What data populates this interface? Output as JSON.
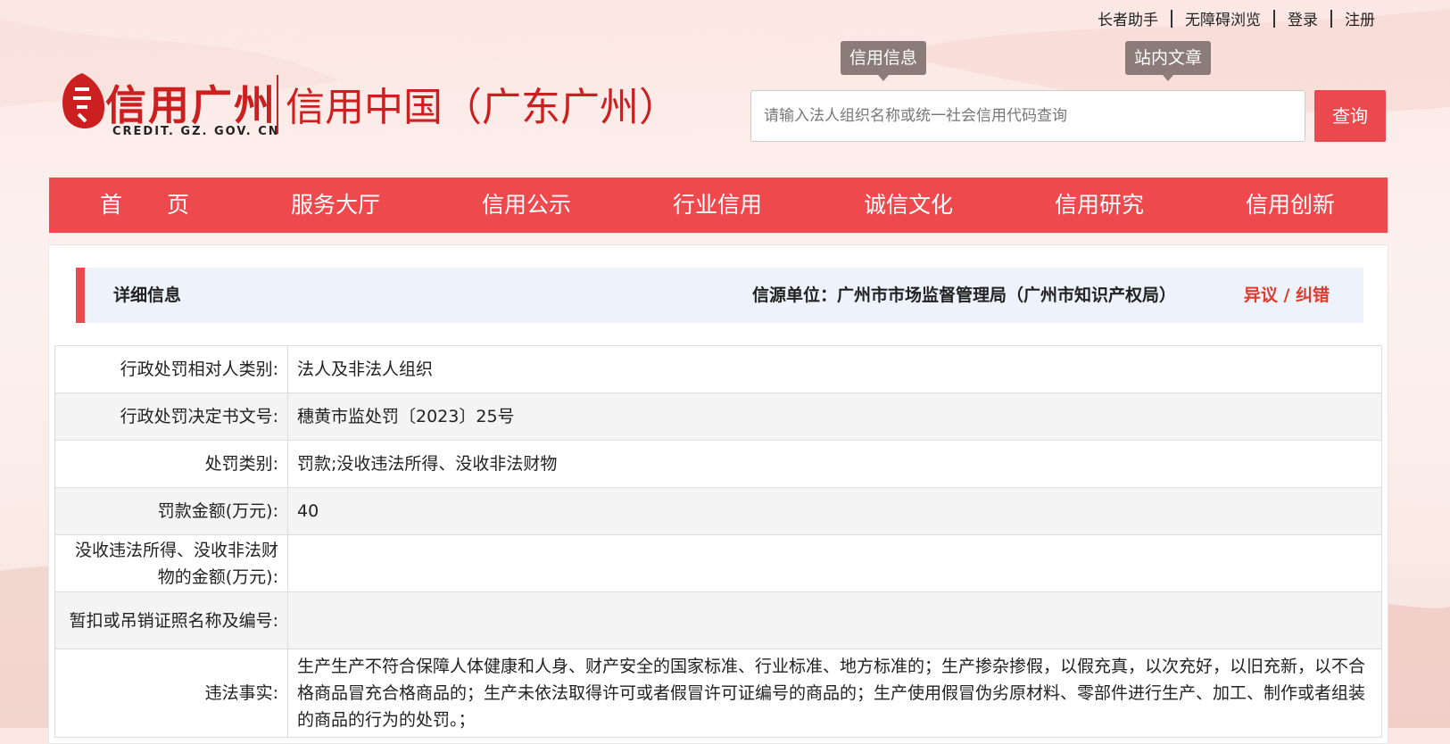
{
  "toplinks": [
    "长者助手",
    "无障碍浏览",
    "登录",
    "注册"
  ],
  "logo": {
    "title_cn": "信用广州",
    "title_en": "CREDIT. GZ. GOV. CN",
    "subtitle": "信用中国（广东广州）"
  },
  "search": {
    "tabs": [
      "信用信息",
      "站内文章"
    ],
    "placeholder": "请输入法人组织名称或统一社会信用代码查询",
    "button": "查询"
  },
  "nav": [
    "首　　页",
    "服务大厅",
    "信用公示",
    "行业信用",
    "诚信文化",
    "信用研究",
    "信用创新"
  ],
  "detail": {
    "title": "详细信息",
    "source": "信源单位：广州市市场监督管理局（广州市知识产权局）",
    "objection": "异议 / 纠错",
    "rows": [
      {
        "label": "行政处罚相对人类别:",
        "value": "法人及非法人组织"
      },
      {
        "label": "行政处罚决定书文号:",
        "value": "穗黄市监处罚〔2023〕25号"
      },
      {
        "label": "处罚类别:",
        "value": "罚款;没收违法所得、没收非法财物"
      },
      {
        "label": "罚款金额(万元):",
        "value": "40"
      },
      {
        "label": "没收违法所得、没收非法财物的金额(万元):",
        "value": ""
      },
      {
        "label": "暂扣或吊销证照名称及编号:",
        "value": ""
      },
      {
        "label": "违法事实:",
        "value": "生产生产不符合保障人体健康和人身、财产安全的国家标准、行业标准、地方标准的；生产掺杂掺假，以假充真，以次充好，以旧充新，以不合格商品冒充合格商品的；生产未依法取得许可或者假冒许可证编号的商品的；生产使用假冒伪劣原材料、零部件进行生产、加工、制作或者组装的商品的行为的处罚。；"
      }
    ]
  }
}
